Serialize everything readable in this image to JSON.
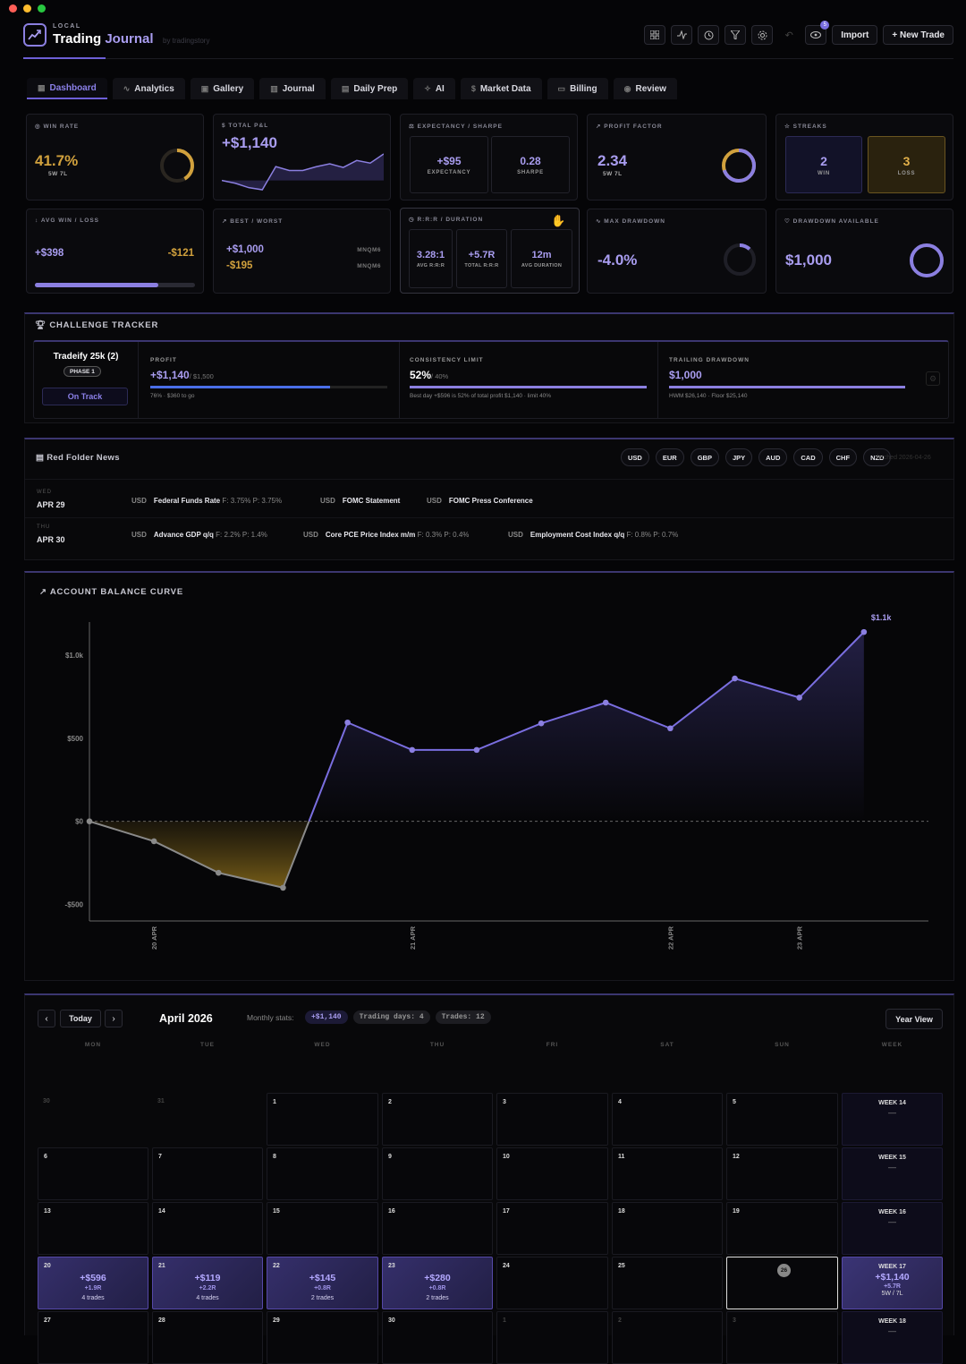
{
  "colors": {
    "accent": "#8b7fe0",
    "gold": "#d1a13d",
    "loss": "#c9a04a",
    "bg": "#050507"
  },
  "header": {
    "brand_sub": "LOCAL",
    "brand_title_1": "Trading",
    "brand_title_2": "Journal",
    "brand_by": "by tradingstory",
    "import_label": "Import",
    "new_trade_label": "+ New Trade",
    "notif_count": "5",
    "icons": [
      "grid-icon",
      "activity-icon",
      "clock-icon",
      "filter-icon",
      "gear-icon",
      "undo-icon",
      "eye-icon"
    ]
  },
  "tabs": [
    {
      "label": "Dashboard",
      "icon": "grid"
    },
    {
      "label": "Analytics",
      "icon": "activity"
    },
    {
      "label": "Gallery",
      "icon": "image"
    },
    {
      "label": "Journal",
      "icon": "book"
    },
    {
      "label": "Daily Prep",
      "icon": "clipboard"
    },
    {
      "label": "AI",
      "icon": "sparkle"
    },
    {
      "label": "Market Data",
      "icon": "dollar"
    },
    {
      "label": "Billing",
      "icon": "card"
    },
    {
      "label": "Review",
      "icon": "eye"
    }
  ],
  "stats": {
    "win_rate": {
      "label": "WIN RATE",
      "value": "41.7%",
      "sub": "5W  7L",
      "ratio": 0.417
    },
    "total_pnl": {
      "label": "TOTAL P&L",
      "value": "+$1,140"
    },
    "expectancy": {
      "label": "EXPECTANCY / SHARPE",
      "exp_value": "+$95",
      "exp_label": "EXPECTANCY",
      "sharpe_value": "0.28",
      "sharpe_label": "SHARPE"
    },
    "profit_factor": {
      "label": "PROFIT FACTOR",
      "value": "2.34",
      "sub": "5W  7L",
      "ratio": 0.7
    },
    "streaks": {
      "label": "STREAKS",
      "win_value": "2",
      "win_label": "WIN",
      "loss_value": "3",
      "loss_label": "LOSS"
    },
    "avg_win_loss": {
      "label": "AVG WIN / LOSS",
      "win": "+$398",
      "loss": "-$121",
      "ratio": 0.77
    },
    "best_worst": {
      "label": "BEST / WORST",
      "best": "+$1,000",
      "worst": "-$195",
      "best_tag": "MNQM6",
      "worst_tag": "MNQM6"
    },
    "rr_duration": {
      "label": "R:R:R / DURATION",
      "avg_rr": "3.28:1",
      "avg_rr_label": "AVG R:R:R",
      "total_rr": "+5.7R",
      "total_rr_label": "TOTAL R:R:R",
      "duration": "12m",
      "duration_label": "AVG DURATION"
    },
    "max_drawdown": {
      "label": "MAX DRAWDOWN",
      "value": "-4.0%",
      "ratio": 0.04
    },
    "drawdown_available": {
      "label": "DRAWDOWN AVAILABLE",
      "value": "$1,000",
      "ratio": 1.0
    }
  },
  "challenge": {
    "title": "CHALLENGE TRACKER",
    "account": "Tradeify 25k (2)",
    "phase": "PHASE 1",
    "status": "On Track",
    "profit_label": "PROFIT",
    "profit_value": "+$1,140",
    "profit_target": "/ $1,500",
    "profit_note": "76% · $360 to go",
    "profit_ratio": 0.76,
    "consistency_label": "CONSISTENCY LIMIT",
    "consistency_value": "52%",
    "consistency_limit": "/ 40%",
    "consistency_note": "Best day +$596 is 52% of total profit $1,140 · limit 40%",
    "consistency_ratio": 1.0,
    "trailing_label": "TRAILING DRAWDOWN",
    "trailing_value": "$1,000",
    "trailing_note": "HWM $26,140 · Floor $25,140",
    "trailing_ratio": 1.0
  },
  "news": {
    "title": "Red Folder News",
    "fetched": "fetched 2026-04-26",
    "currencies": [
      "USD",
      "EUR",
      "GBP",
      "JPY",
      "AUD",
      "CAD",
      "CHF",
      "NZD"
    ],
    "days": [
      {
        "weekday": "WED",
        "date": "APR 29",
        "events": [
          {
            "ccy": "USD",
            "name": "Federal Funds Rate",
            "fp": "F: 3.75%  P: 3.75%"
          },
          {
            "ccy": "USD",
            "name": "FOMC Statement",
            "fp": ""
          },
          {
            "ccy": "USD",
            "name": "FOMC Press Conference",
            "fp": ""
          }
        ]
      },
      {
        "weekday": "THU",
        "date": "APR 30",
        "events": [
          {
            "ccy": "USD",
            "name": "Advance GDP q/q",
            "fp": "F: 2.2%  P: 1.4%"
          },
          {
            "ccy": "USD",
            "name": "Core PCE Price Index m/m",
            "fp": "F: 0.3%  P: 0.4%"
          },
          {
            "ccy": "USD",
            "name": "Employment Cost Index q/q",
            "fp": "F: 0.8%  P: 0.7%"
          }
        ]
      }
    ]
  },
  "chart_data": {
    "type": "line",
    "title": "ACCOUNT BALANCE CURVE",
    "ylim": [
      -600,
      1200
    ],
    "y_ticks": [
      {
        "v": 1000,
        "label": "$1.0k"
      },
      {
        "v": 500,
        "label": "$500"
      },
      {
        "v": 0,
        "label": "$0"
      },
      {
        "v": -500,
        "label": "-$500"
      }
    ],
    "x_ticks": [
      {
        "i": 1,
        "label": "20 APR"
      },
      {
        "i": 5,
        "label": "21 APR"
      },
      {
        "i": 9,
        "label": "22 APR"
      },
      {
        "i": 11,
        "label": "23 APR"
      }
    ],
    "values": [
      0,
      -120,
      -310,
      -400,
      595,
      430,
      430,
      590,
      715,
      560,
      860,
      745,
      1140
    ],
    "end_label": "$1.1k"
  },
  "calendar": {
    "prev": "‹",
    "today": "Today",
    "next": "›",
    "month": "April 2026",
    "stats_label": "Monthly stats:",
    "pnl_pill": "+$1,140",
    "days_pill": "Trading days: 4",
    "trades_pill": "Trades: 12",
    "year_view": "Year View",
    "headers": [
      "MON",
      "TUE",
      "WED",
      "THU",
      "FRI",
      "SAT",
      "SUN",
      "WEEK"
    ],
    "weeks": [
      {
        "days": [
          {
            "d": "30",
            "off": true
          },
          {
            "d": "31",
            "off": true
          },
          {
            "d": "1"
          },
          {
            "d": "2"
          },
          {
            "d": "3"
          },
          {
            "d": "4"
          },
          {
            "d": "5"
          }
        ],
        "label": "WEEK 14",
        "sum": "—"
      },
      {
        "days": [
          {
            "d": "6"
          },
          {
            "d": "7"
          },
          {
            "d": "8"
          },
          {
            "d": "9"
          },
          {
            "d": "10"
          },
          {
            "d": "11"
          },
          {
            "d": "12"
          }
        ],
        "label": "WEEK 15",
        "sum": "—"
      },
      {
        "days": [
          {
            "d": "13"
          },
          {
            "d": "14"
          },
          {
            "d": "15"
          },
          {
            "d": "16"
          },
          {
            "d": "17"
          },
          {
            "d": "18"
          },
          {
            "d": "19"
          }
        ],
        "label": "WEEK 16",
        "sum": "—"
      },
      {
        "days": [
          {
            "d": "20",
            "pnl": "+$596",
            "rr": "+1.9R",
            "tc": "4 trades"
          },
          {
            "d": "21",
            "pnl": "+$119",
            "rr": "+2.2R",
            "tc": "4 trades"
          },
          {
            "d": "22",
            "pnl": "+$145",
            "rr": "+0.8R",
            "tc": "2 trades"
          },
          {
            "d": "23",
            "pnl": "+$280",
            "rr": "+0.8R",
            "tc": "2 trades"
          },
          {
            "d": "24"
          },
          {
            "d": "25"
          },
          {
            "d": "26",
            "today": true
          }
        ],
        "label": "WEEK 17",
        "pnl": "+$1,140",
        "rr": "+5.7R",
        "wl": "5W / 7L"
      },
      {
        "days": [
          {
            "d": "27"
          },
          {
            "d": "28"
          },
          {
            "d": "29"
          },
          {
            "d": "30"
          },
          {
            "d": "1",
            "off": true
          },
          {
            "d": "2",
            "off": true
          },
          {
            "d": "3",
            "off": true
          }
        ],
        "label": "WEEK 18",
        "sum": "—"
      }
    ]
  }
}
